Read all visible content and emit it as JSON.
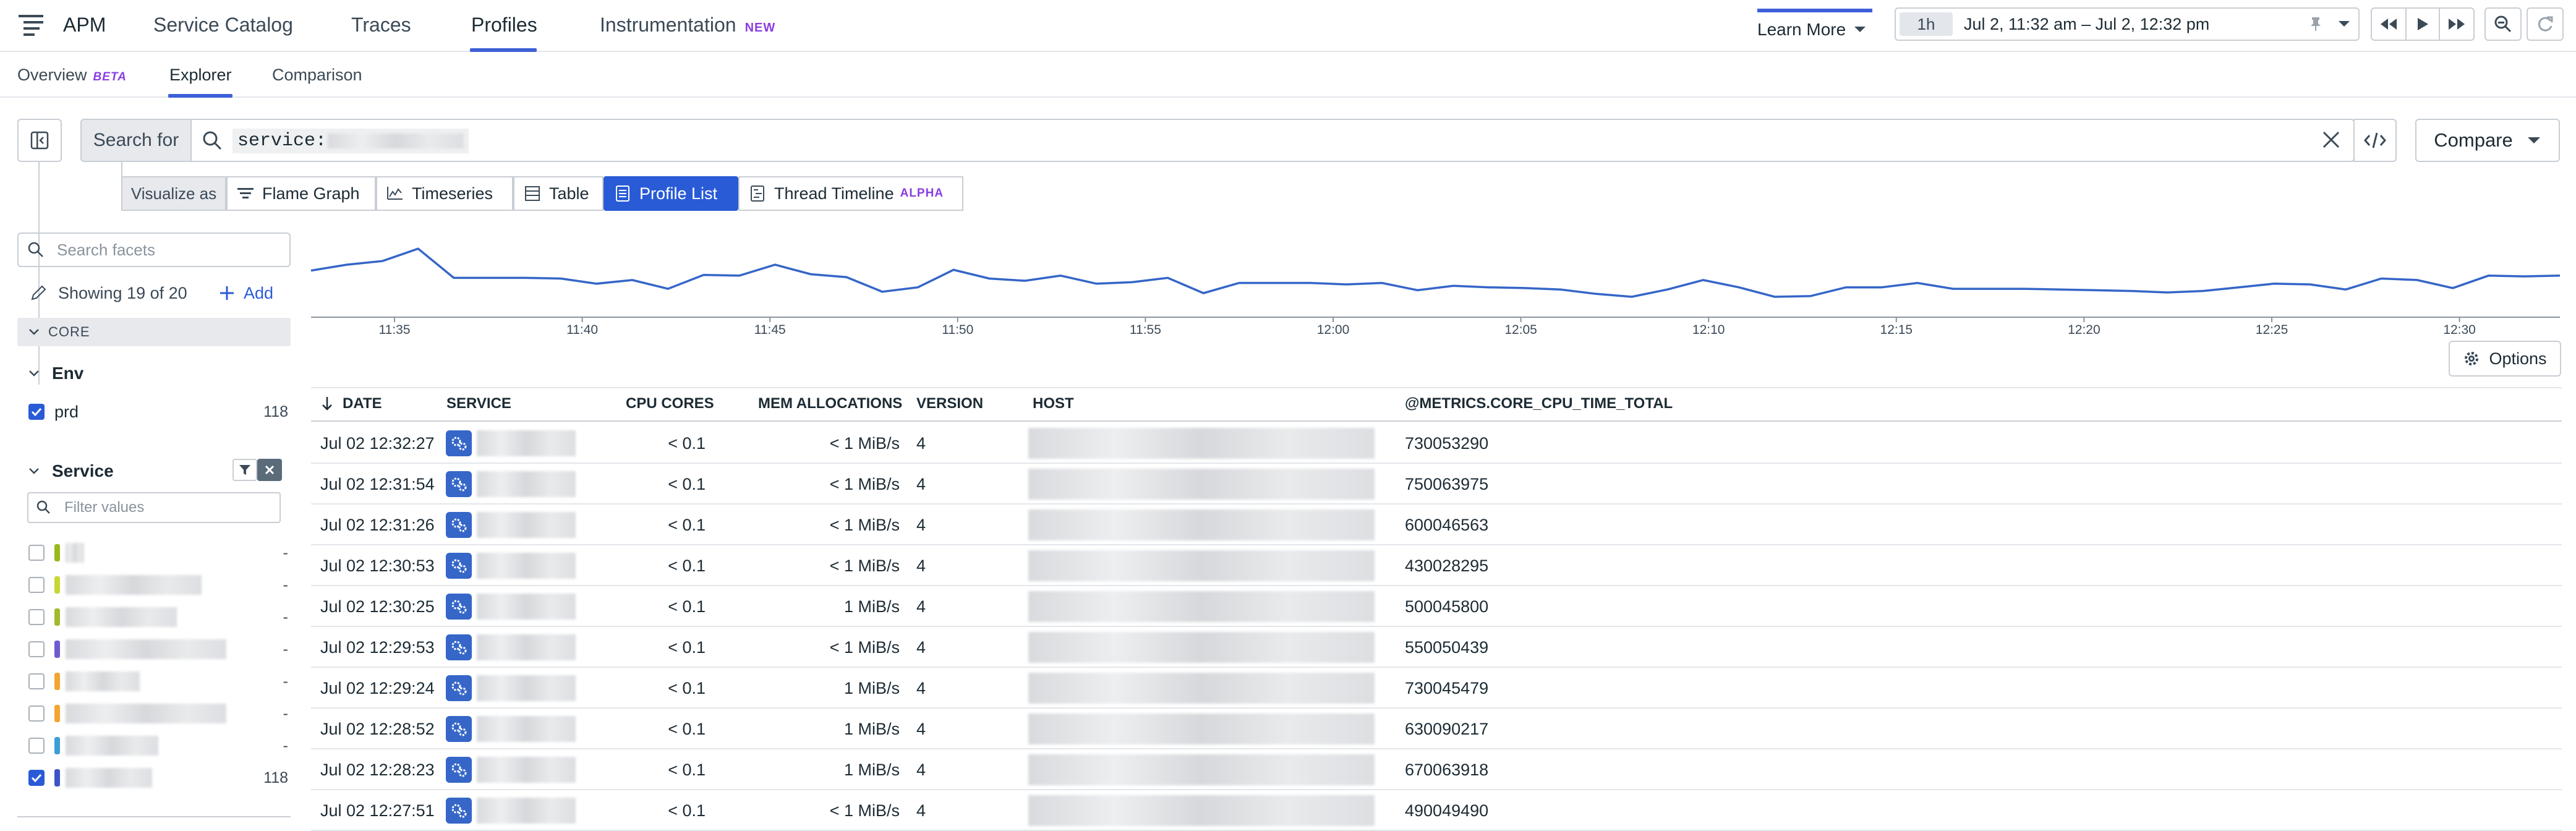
{
  "topnav": {
    "app": "APM",
    "links": [
      {
        "label": "Service Catalog"
      },
      {
        "label": "Traces"
      },
      {
        "label": "Profiles"
      },
      {
        "label": "Instrumentation",
        "badge": "NEW"
      }
    ],
    "learn_more": "Learn More",
    "time_preset": "1h",
    "time_range": "Jul 2, 11:32 am – Jul 2, 12:32 pm"
  },
  "subnav": {
    "tabs": [
      {
        "label": "Overview",
        "badge": "BETA"
      },
      {
        "label": "Explorer"
      },
      {
        "label": "Comparison"
      }
    ]
  },
  "search": {
    "label": "Search for",
    "query_prefix": "service:",
    "compare": "Compare"
  },
  "visualize": {
    "label": "Visualize as",
    "options": [
      {
        "label": "Flame Graph"
      },
      {
        "label": "Timeseries"
      },
      {
        "label": "Table"
      },
      {
        "label": "Profile List",
        "selected": true
      },
      {
        "label": "Thread Timeline",
        "badge": "ALPHA"
      }
    ]
  },
  "sidebar": {
    "search_placeholder": "Search facets",
    "showing": "Showing 19 of 20",
    "add": "Add",
    "group": "CORE",
    "env": {
      "title": "Env",
      "items": [
        {
          "label": "prd",
          "count": "118",
          "checked": true
        }
      ]
    },
    "service": {
      "title": "Service",
      "filter_placeholder": "Filter values",
      "items": [
        {
          "count": "-",
          "color": "#9ab81a",
          "checked": false
        },
        {
          "count": "-",
          "color": "#c8d633",
          "checked": false
        },
        {
          "count": "-",
          "color": "#a4b92a",
          "checked": false
        },
        {
          "count": "-",
          "color": "#6d5bd0",
          "checked": false
        },
        {
          "count": "-",
          "color": "#f2a531",
          "checked": false
        },
        {
          "count": "-",
          "color": "#f2a531",
          "checked": false
        },
        {
          "count": "-",
          "color": "#3a9fd6",
          "checked": false
        },
        {
          "count": "118",
          "color": "#3c54c8",
          "checked": true
        }
      ]
    }
  },
  "chart_data": {
    "type": "line",
    "x_ticks": [
      "11:35",
      "11:40",
      "11:45",
      "11:50",
      "11:55",
      "12:00",
      "12:05",
      "12:10",
      "12:15",
      "12:20",
      "12:25",
      "12:30"
    ],
    "values": [
      0.58,
      0.66,
      0.71,
      0.88,
      0.48,
      0.48,
      0.48,
      0.47,
      0.4,
      0.45,
      0.33,
      0.52,
      0.51,
      0.66,
      0.53,
      0.49,
      0.29,
      0.35,
      0.59,
      0.47,
      0.44,
      0.51,
      0.4,
      0.42,
      0.48,
      0.27,
      0.41,
      0.41,
      0.41,
      0.39,
      0.41,
      0.31,
      0.37,
      0.35,
      0.34,
      0.32,
      0.26,
      0.22,
      0.32,
      0.45,
      0.35,
      0.22,
      0.23,
      0.35,
      0.35,
      0.41,
      0.33,
      0.33,
      0.33,
      0.32,
      0.31,
      0.3,
      0.28,
      0.3,
      0.35,
      0.4,
      0.39,
      0.32,
      0.47,
      0.45,
      0.34,
      0.51,
      0.5,
      0.51
    ],
    "ylim": [
      0,
      1
    ],
    "grid": false
  },
  "options_label": "Options",
  "table": {
    "columns": [
      "DATE",
      "SERVICE",
      "CPU CORES",
      "MEM ALLOCATIONS",
      "VERSION",
      "HOST",
      "@METRICS.CORE_CPU_TIME_TOTAL"
    ],
    "rows": [
      {
        "date": "Jul 02 12:32:27",
        "cpu": "< 0.1",
        "mem": "< 1 MiB/s",
        "version": "4",
        "cpu_time": "730053290"
      },
      {
        "date": "Jul 02 12:31:54",
        "cpu": "< 0.1",
        "mem": "< 1 MiB/s",
        "version": "4",
        "cpu_time": "750063975"
      },
      {
        "date": "Jul 02 12:31:26",
        "cpu": "< 0.1",
        "mem": "< 1 MiB/s",
        "version": "4",
        "cpu_time": "600046563"
      },
      {
        "date": "Jul 02 12:30:53",
        "cpu": "< 0.1",
        "mem": "< 1 MiB/s",
        "version": "4",
        "cpu_time": "430028295"
      },
      {
        "date": "Jul 02 12:30:25",
        "cpu": "< 0.1",
        "mem": "1 MiB/s",
        "version": "4",
        "cpu_time": "500045800"
      },
      {
        "date": "Jul 02 12:29:53",
        "cpu": "< 0.1",
        "mem": "< 1 MiB/s",
        "version": "4",
        "cpu_time": "550050439"
      },
      {
        "date": "Jul 02 12:29:24",
        "cpu": "< 0.1",
        "mem": "1 MiB/s",
        "version": "4",
        "cpu_time": "730045479"
      },
      {
        "date": "Jul 02 12:28:52",
        "cpu": "< 0.1",
        "mem": "1 MiB/s",
        "version": "4",
        "cpu_time": "630090217"
      },
      {
        "date": "Jul 02 12:28:23",
        "cpu": "< 0.1",
        "mem": "1 MiB/s",
        "version": "4",
        "cpu_time": "670063918"
      },
      {
        "date": "Jul 02 12:27:51",
        "cpu": "< 0.1",
        "mem": "< 1 MiB/s",
        "version": "4",
        "cpu_time": "490049490"
      }
    ]
  }
}
